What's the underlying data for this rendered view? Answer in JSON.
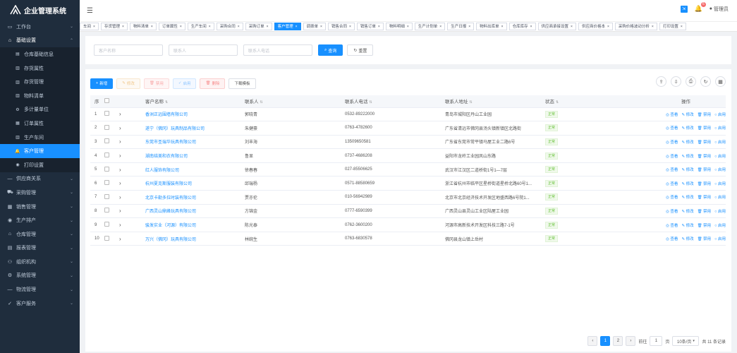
{
  "app": {
    "title": "企业管理系统"
  },
  "sidebar": {
    "items": [
      {
        "label": "工作台",
        "icon": "monitor-icon"
      },
      {
        "label": "基础设置",
        "icon": "home-icon",
        "open": true,
        "children": [
          {
            "label": "仓库基础信息",
            "icon": "building-icon"
          },
          {
            "label": "存货属性",
            "icon": "document-icon"
          },
          {
            "label": "存货管理",
            "icon": "document-icon"
          },
          {
            "label": "物料清单",
            "icon": "document-icon"
          },
          {
            "label": "多计量单位",
            "icon": "gear-icon"
          },
          {
            "label": "订单属性",
            "icon": "grid-icon"
          },
          {
            "label": "生产车间",
            "icon": "document-icon"
          },
          {
            "label": "客户管理",
            "icon": "bell-icon",
            "active": true
          },
          {
            "label": "打印设置",
            "icon": "user-icon"
          }
        ]
      },
      {
        "label": "供应商关系",
        "icon": "dash-icon"
      },
      {
        "label": "采购管理",
        "icon": "cart-icon"
      },
      {
        "label": "销售管理",
        "icon": "grid-icon"
      },
      {
        "label": "生产排产",
        "icon": "user-icon"
      },
      {
        "label": "仓库管理",
        "icon": "home-icon"
      },
      {
        "label": "报表管理",
        "icon": "chart-icon"
      },
      {
        "label": "组织机构",
        "icon": "org-icon"
      },
      {
        "label": "系统管理",
        "icon": "gear-icon"
      },
      {
        "label": "物流管理",
        "icon": "dash-icon"
      },
      {
        "label": "客户服务",
        "icon": "check-icon"
      }
    ]
  },
  "header": {
    "notification_count": "6",
    "user": "管理员"
  },
  "tabs": [
    "车间",
    "存货管理",
    "物料清单",
    "订单属性",
    "生产车间",
    "采购合同",
    "采购订单",
    "客户管理",
    "调拨单",
    "销售合同",
    "销售订单",
    "物料明细",
    "生产计划单",
    "生产日报",
    "物料出库单",
    "仓库库存",
    "供应商承接设置",
    "供应商价格本",
    "采购价格波动分析",
    "打印设置"
  ],
  "active_tab": "客户管理",
  "search": {
    "name_placeholder": "客户名称",
    "contact_placeholder": "联系人",
    "phone_placeholder": "联系人电话",
    "search_label": "查询",
    "reset_label": "重置"
  },
  "toolbar": {
    "add": "新增",
    "edit": "修改",
    "disable": "禁用",
    "enable": "启用",
    "delete": "删除",
    "template": "下载模板"
  },
  "table": {
    "headers": [
      "序",
      "客户名称",
      "联系人",
      "联系人电话",
      "联系人地址",
      "状态",
      "操作"
    ],
    "rows": [
      [
        "1",
        "香洲正远围墙有限公司",
        "郭晓青",
        "0532-89222000",
        "青岛市城阳区丹山工业园",
        "正常"
      ],
      [
        "2",
        "遂宁（佛冈）玩具制品有限公司",
        "朱健豪",
        "0763-4782600",
        "广东省清远市佛冈县汤头镇新镇区北路街",
        "正常"
      ],
      [
        "3",
        "东莞市圣瑞华玩具有限公司",
        "刘丰海",
        "13509650581",
        "广东省东莞市常平镇马屋工业二路6号",
        "正常"
      ],
      [
        "4",
        "湖南结美和衣有限公司",
        "鲁显",
        "0737-4686208",
        "益阳市龙岭工业园凤山东路",
        "正常"
      ],
      [
        "5",
        "红人服饰有限公司",
        "徐春春",
        "027-85506625",
        "武汉市江汉区二道桥街1号1—7层",
        "正常"
      ],
      [
        "6",
        "杭州夏克斯服装有限公司",
        "邱瑞杨",
        "0571-88580659",
        "浙江省杭州市临平区星桥街道星桥北路60号1...",
        "正常"
      ],
      [
        "7",
        "北京卡勒多拉时装有限公司",
        "贾亦伦",
        "010-56942989",
        "北京市北京经济技术开发区地盛西路6号院1...",
        "正常"
      ],
      [
        "8",
        "广西灵山鼎峰玩具有限公司",
        "方锦金",
        "0777-6590399",
        "广西灵山县灵山工业区陆屋工业园",
        "正常"
      ],
      [
        "9",
        "骏发实业（河源）有限公司",
        "陈光泰",
        "0762-3600200",
        "河源市高新技术开发区科技三路7-1号",
        "正常"
      ],
      [
        "10",
        "万兴（佛冈）玩具有限公司",
        "林婉生",
        "0763-6830578",
        "佛冈县龙山镇上岳村",
        "正常"
      ]
    ],
    "ops": [
      "查看",
      "修改",
      "禁用",
      "启用"
    ]
  },
  "pagination": {
    "pages": [
      "1",
      "2"
    ],
    "current": "1",
    "goto_label": "前往",
    "goto_value": "1",
    "page_unit": "页",
    "page_size": "10条/页",
    "total": "共 11 条记录"
  }
}
